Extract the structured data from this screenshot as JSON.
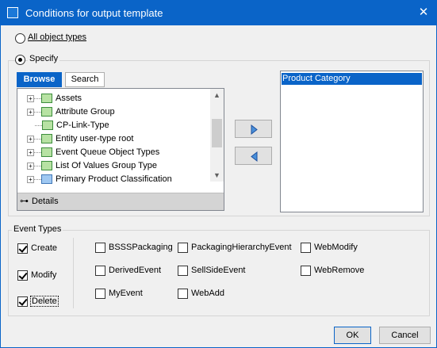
{
  "window": {
    "title": "Conditions for output template",
    "close_glyph": "✕"
  },
  "scope": {
    "all_label": "All object types",
    "specify_label": "Specify",
    "selected": "specify"
  },
  "tabs": [
    {
      "label": "Browse",
      "active": true
    },
    {
      "label": "Search",
      "active": false
    }
  ],
  "tree": {
    "items": [
      {
        "label": "Assets",
        "expander": "+",
        "icon": "assets-icon"
      },
      {
        "label": "Attribute Group",
        "expander": "+",
        "icon": "attribute-folder-icon"
      },
      {
        "label": "CP-Link-Type",
        "expander": "",
        "icon": "link-type-folder-icon"
      },
      {
        "label": "Entity user-type root",
        "expander": "+",
        "icon": "entity-folder-icon"
      },
      {
        "label": "Event Queue Object Types",
        "expander": "+",
        "icon": "event-folder-icon"
      },
      {
        "label": "List Of Values Group Type",
        "expander": "+",
        "icon": "lov-folder-icon"
      },
      {
        "label": "Primary Product Classification",
        "expander": "+",
        "icon": "classification-folder-icon"
      }
    ],
    "details_label": "Details"
  },
  "selected_list": {
    "items": [
      "Product Category"
    ]
  },
  "event_types": {
    "legend": "Event Types",
    "primary": [
      {
        "label": "Create",
        "checked": true
      },
      {
        "label": "Modify",
        "checked": true
      },
      {
        "label": "Delete",
        "checked": true
      }
    ],
    "options": [
      {
        "label": "BSSSPackaging",
        "checked": false
      },
      {
        "label": "PackagingHierarchyEvent",
        "checked": false
      },
      {
        "label": "WebModify",
        "checked": false
      },
      {
        "label": "DerivedEvent",
        "checked": false
      },
      {
        "label": "SellSideEvent",
        "checked": false
      },
      {
        "label": "WebRemove",
        "checked": false
      },
      {
        "label": "MyEvent",
        "checked": false
      },
      {
        "label": "WebAdd",
        "checked": false
      }
    ]
  },
  "footer": {
    "ok_label": "OK",
    "cancel_label": "Cancel"
  },
  "colors": {
    "accent": "#0a64c8",
    "selection": "#0a64c8"
  }
}
